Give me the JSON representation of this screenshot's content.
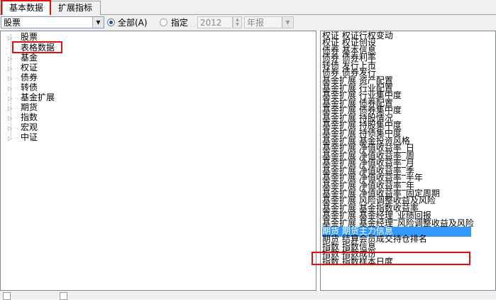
{
  "tabs": [
    {
      "label": "基本数据",
      "active": true
    },
    {
      "label": "扩展指标",
      "active": false
    }
  ],
  "toolbar": {
    "category_value": "股票",
    "radio_all_label": "全部(A)",
    "radio_all_checked": true,
    "radio_specify_label": "指定",
    "radio_specify_checked": false,
    "year_value": "2012",
    "period_value": "年报"
  },
  "tree": {
    "items": [
      {
        "label": "股票"
      },
      {
        "label": "表格数据"
      },
      {
        "label": "基金"
      },
      {
        "label": "权证"
      },
      {
        "label": "债券"
      },
      {
        "label": "转债"
      },
      {
        "label": "基金扩展"
      },
      {
        "label": "期货"
      },
      {
        "label": "指数"
      },
      {
        "label": "宏观"
      },
      {
        "label": "中证"
      }
    ],
    "highlighted": "表格数据"
  },
  "list": {
    "rows": [
      "权证  权证行权变动",
      "权证  权证创设",
      "债券  基本信息",
      "债券  债券利率",
      "转债  发行上市",
      "债券  债券发行",
      "基金扩展  资产配置",
      "基金扩展  行业配置",
      "基金扩展  行业集中度",
      "基金扩展  债券配置",
      "基金扩展  债券集中度",
      "基金扩展  持股情况",
      "基金扩展  持股集中度",
      "基金扩展  持债集中度",
      "基金扩展  基金投资风格",
      "基金扩展  净值收益率_日",
      "基金扩展  净值收益率_周",
      "基金扩展  净值收益率_月",
      "基金扩展  净值收益率_季",
      "基金扩展  净值收益率_半年",
      "基金扩展  净值收益率_年",
      "基金扩展  净值收益率_固定周期",
      "基金扩展  风险调整收益及风险",
      "基金扩展  基金指数收益率",
      "基金扩展  基金经理_业绩回报",
      "基金扩展  基金经理_风险调整收益及风险",
      "期货  期货主力信息",
      "期货  结算会员成交持仓排名",
      "指数  指数信息",
      "指数  指数成份",
      "指数  指数样本日度"
    ],
    "selected_row": "期货  期货主力信息"
  },
  "colors": {
    "highlight_box": "#e01010",
    "selection": "#3399ff"
  }
}
